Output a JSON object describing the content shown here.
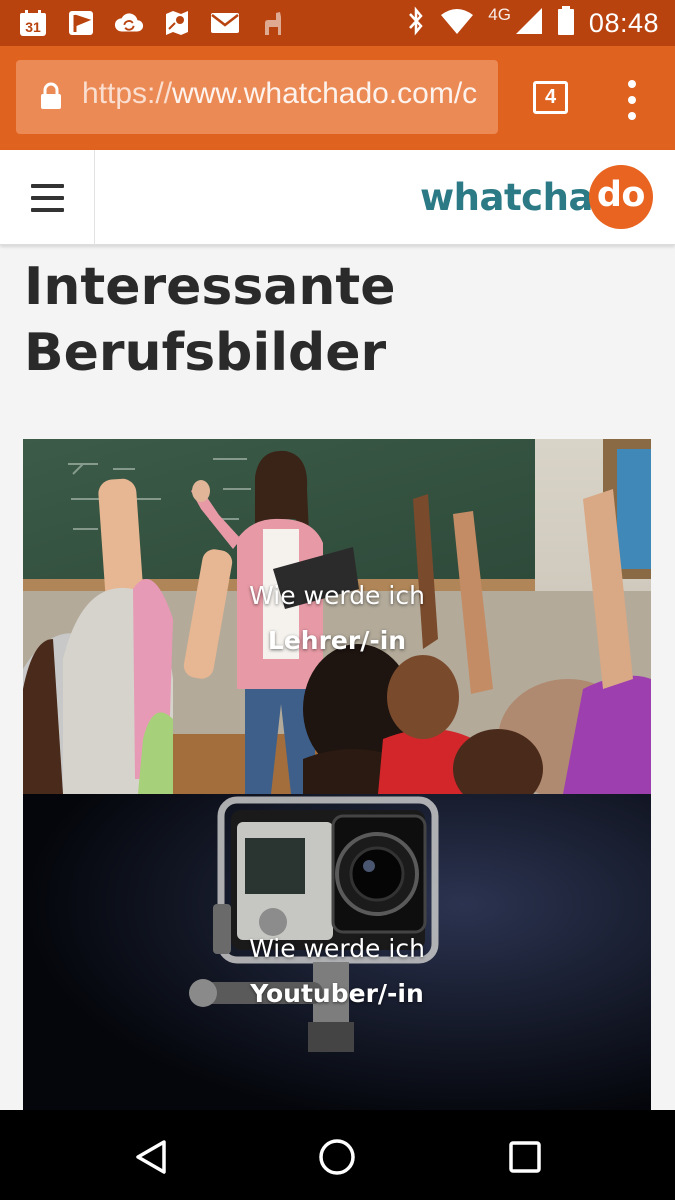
{
  "status_bar": {
    "time": "08:48",
    "network": "4G",
    "calendar_day": "31",
    "icons": [
      "calendar-icon",
      "flag-icon",
      "cloud-sync-icon",
      "maps-icon",
      "mail-icon",
      "llama-icon",
      "bluetooth-icon",
      "wifi-icon",
      "signal-icon",
      "battery-icon"
    ]
  },
  "browser": {
    "url_https": "https://",
    "url_rest": "www.whatchado.com/c",
    "tab_count": "4"
  },
  "site": {
    "logo_main": "whatcha",
    "logo_bubble": "do",
    "colors": {
      "teal": "#2b7a85",
      "orange": "#e96420",
      "toolbar": "#e0621f",
      "status": "#b8430f"
    }
  },
  "content": {
    "title_line1": "Interessante",
    "title_line2": "Berufsbilder",
    "cards": [
      {
        "line1": "Wie werde ich",
        "line2": "Lehrer/-in"
      },
      {
        "line1": "Wie werde ich",
        "line2": "Youtuber/-in"
      }
    ]
  },
  "nav": {
    "icons": [
      "back-icon",
      "home-icon",
      "recents-icon"
    ]
  }
}
